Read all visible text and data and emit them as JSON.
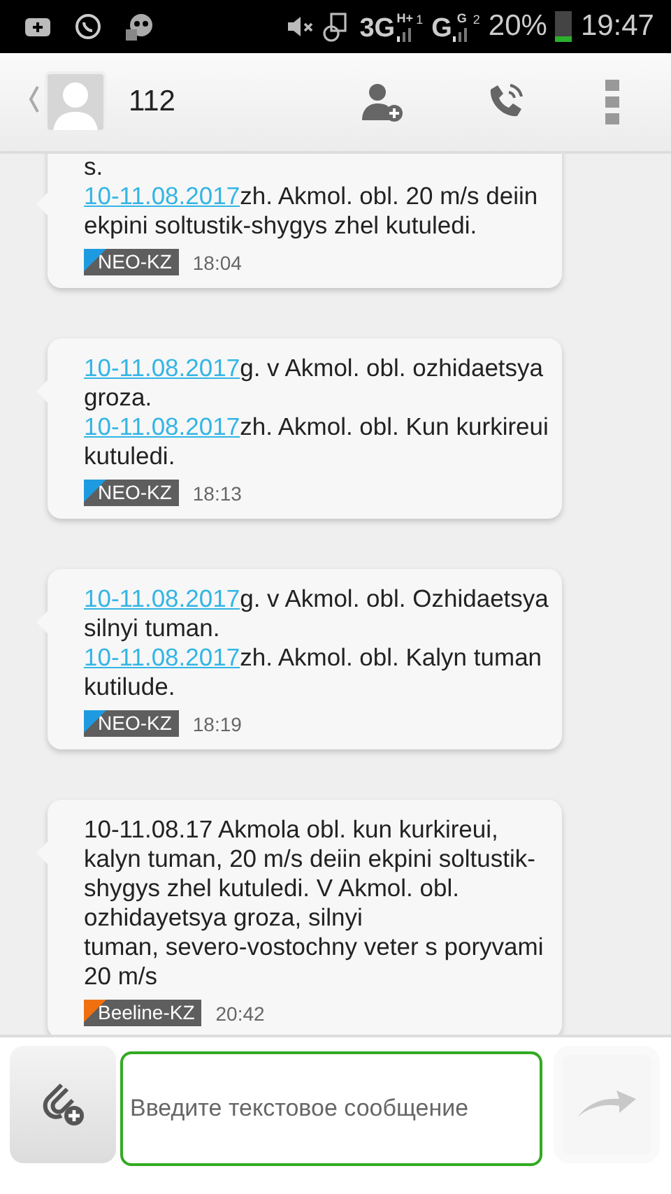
{
  "status_bar": {
    "network_1": "3G",
    "network_1_type": "H+",
    "sim_1": "1",
    "network_2": "G",
    "network_2_type": "G",
    "sim_2": "2",
    "battery": "20%",
    "time": "19:47"
  },
  "header": {
    "contact": "112"
  },
  "messages": [
    {
      "paragraphs": [
        {
          "text": "s."
        },
        {
          "link": "10-11.08.2017",
          "text": "zh. Akmol. obl. 20 m/s deiin ekpini soltustik-shygys zhel kutuledi."
        }
      ],
      "sender": "NEO-KZ",
      "color": "#1e9be0",
      "time": "18:04"
    },
    {
      "paragraphs": [
        {
          "link": "10-11.08.2017",
          "text": "g. v Akmol. obl. ozhidaetsya groza."
        },
        {
          "link": "10-11.08.2017",
          "text": "zh. Akmol. obl. Kun kurkireui kutuledi."
        }
      ],
      "sender": "NEO-KZ",
      "color": "#1e9be0",
      "time": "18:13"
    },
    {
      "paragraphs": [
        {
          "link": "10-11.08.2017",
          "text": "g. v Akmol. obl. Ozhidaetsya silnyi tuman."
        },
        {
          "link": "10-11.08.2017",
          "text": "zh. Akmol. obl. Kalyn tuman kutilude."
        }
      ],
      "sender": "NEO-KZ",
      "color": "#1e9be0",
      "time": "18:19"
    },
    {
      "paragraphs": [
        {
          "text": "10-11.08.17 Akmola obl. kun kurkireui, kalyn tuman, 20 m/s deiin ekpini soltustik-shygys zhel kutuledi. V Akmol. obl. ozhidayetsya groza, silnyi"
        },
        {
          "text": "tuman, severo-vostochny veter s poryvami 20 m/s"
        }
      ],
      "sender": "Beeline-KZ",
      "color": "#f07010",
      "time": "20:42"
    }
  ],
  "composer": {
    "placeholder": "Введите текстовое сообщение",
    "focused": true
  }
}
